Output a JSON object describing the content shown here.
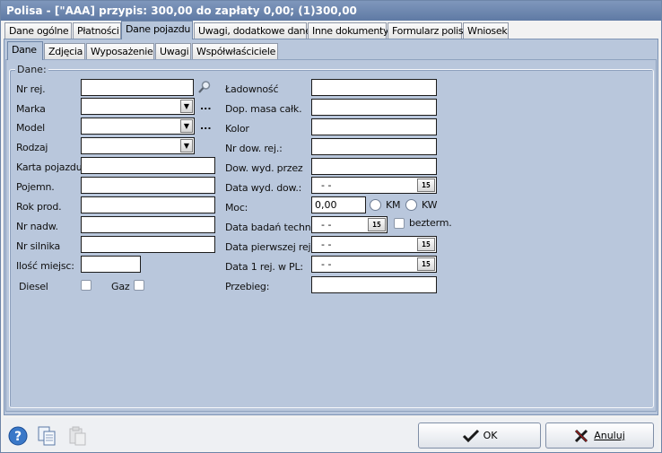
{
  "window": {
    "title": "Polisa - [\"AAA]  przypis: 300,00 do zapłaty 0,00; (1)300,00"
  },
  "tabs": [
    {
      "label": "Dane ogólne"
    },
    {
      "label": "Płatności"
    },
    {
      "label": "Dane pojazdu"
    },
    {
      "label": "Uwagi, dodatkowe dane"
    },
    {
      "label": "Inne dokumenty"
    },
    {
      "label": "Formularz polisy"
    },
    {
      "label": "Wniosek"
    }
  ],
  "subtabs": [
    {
      "label": "Dane"
    },
    {
      "label": "Zdjęcia"
    },
    {
      "label": "Wyposażenie"
    },
    {
      "label": "Uwagi"
    },
    {
      "label": "Współwłaściciele"
    }
  ],
  "group_label": "Dane:",
  "left": {
    "nr_rej": {
      "label": "Nr rej.",
      "value": ""
    },
    "marka": {
      "label": "Marka",
      "value": ""
    },
    "model": {
      "label": "Model",
      "value": ""
    },
    "rodzaj": {
      "label": "Rodzaj",
      "value": ""
    },
    "karta": {
      "label": "Karta pojazdu:",
      "value": ""
    },
    "pojemn": {
      "label": "Pojemn.",
      "value": ""
    },
    "rok": {
      "label": "Rok prod.",
      "value": ""
    },
    "nadw": {
      "label": "Nr nadw.",
      "value": ""
    },
    "silnika": {
      "label": "Nr silnika",
      "value": ""
    },
    "miejsc": {
      "label": "Ilość miejsc:",
      "value": ""
    },
    "diesel": {
      "label": "Diesel"
    },
    "gaz": {
      "label": "Gaz"
    },
    "ellipsis": "..."
  },
  "right": {
    "ladownosc": {
      "label": "Ładowność",
      "value": ""
    },
    "dop_masa": {
      "label": "Dop. masa całk.",
      "value": ""
    },
    "kolor": {
      "label": "Kolor",
      "value": ""
    },
    "nr_dow": {
      "label": "Nr dow. rej.:",
      "value": ""
    },
    "dow_wyd": {
      "label": "Dow. wyd. przez",
      "value": ""
    },
    "data_wyd": {
      "label": "Data wyd. dow.:",
      "value": " - -"
    },
    "moc": {
      "label": "Moc:",
      "value": "0,00"
    },
    "km": {
      "label": "KM"
    },
    "kw": {
      "label": "KW"
    },
    "badan": {
      "label": "Data badań techn.:",
      "value": " - -"
    },
    "bezterm": {
      "label": "bezterm."
    },
    "pierwszej": {
      "label": "Data pierwszej rej.:",
      "value": " - -"
    },
    "pl": {
      "label": "Data 1 rej. w PL:",
      "value": " - -"
    },
    "przebieg": {
      "label": "Przebieg:",
      "value": ""
    },
    "cal_label": "15"
  },
  "buttons": {
    "ok": "OK",
    "cancel": "Anuluj"
  },
  "icons": {
    "help": "help-icon",
    "copy": "copy-icon",
    "paste": "paste-icon",
    "search": "search-icon",
    "ok": "check-icon",
    "cancel": "x-icon"
  }
}
